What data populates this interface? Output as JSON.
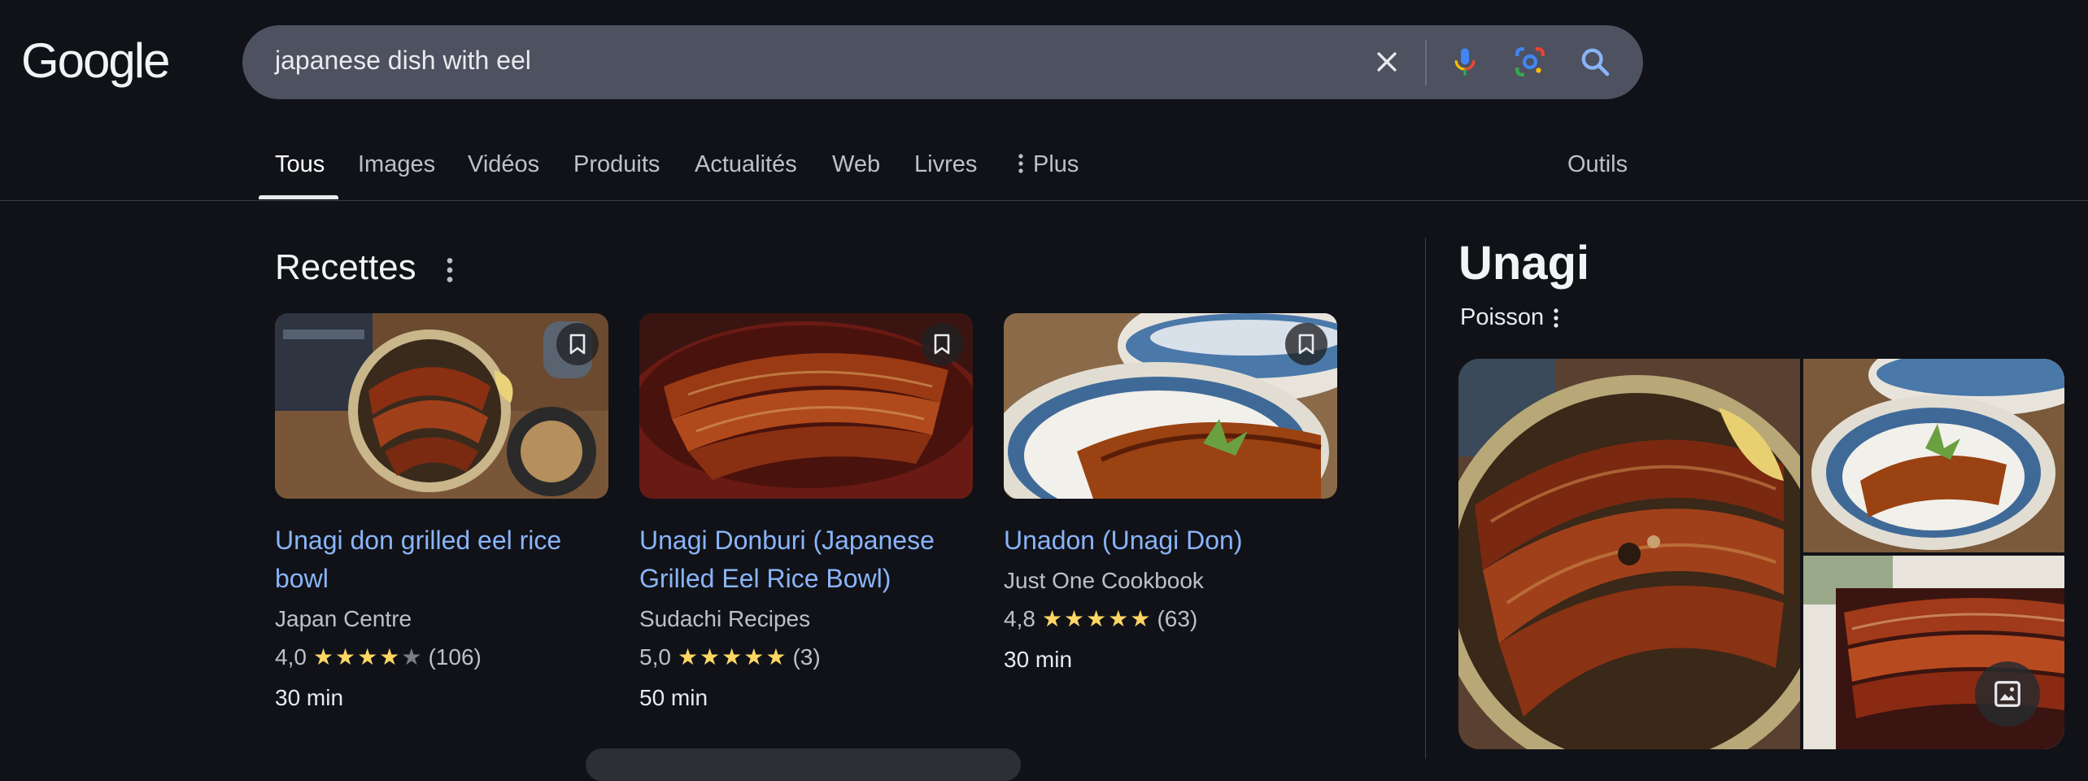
{
  "logo": "Google",
  "search": {
    "query": "japanese dish with eel"
  },
  "tabs": {
    "items": [
      "Tous",
      "Images",
      "Vidéos",
      "Produits",
      "Actualités",
      "Web",
      "Livres"
    ],
    "more": "Plus",
    "tools": "Outils",
    "active": "Tous"
  },
  "recipes": {
    "title": "Recettes",
    "cards": [
      {
        "title": "Unagi don grilled eel rice bowl",
        "source": "Japan Centre",
        "rating": "4,0",
        "stars": 4,
        "count": "(106)",
        "time": "30 min"
      },
      {
        "title": "Unagi Donburi (Japanese Grilled Eel Rice Bowl)",
        "source": "Sudachi Recipes",
        "rating": "5,0",
        "stars": 5,
        "count": "(3)",
        "time": "50 min"
      },
      {
        "title": "Unadon (Unagi Don)",
        "source": "Just One Cookbook",
        "rating": "4,8",
        "stars": 5,
        "count": "(63)",
        "time": "30 min"
      }
    ]
  },
  "knowledge_panel": {
    "title": "Unagi",
    "subtitle": "Poisson"
  },
  "colors": {
    "background": "#101218",
    "search_bar": "#4d5160",
    "link": "#8ab4f8",
    "star": "#fdd663"
  },
  "icons": [
    "close-icon",
    "microphone-icon",
    "google-lens-icon",
    "search-icon",
    "more-vert-icon",
    "bookmark-icon",
    "image-gallery-icon"
  ]
}
